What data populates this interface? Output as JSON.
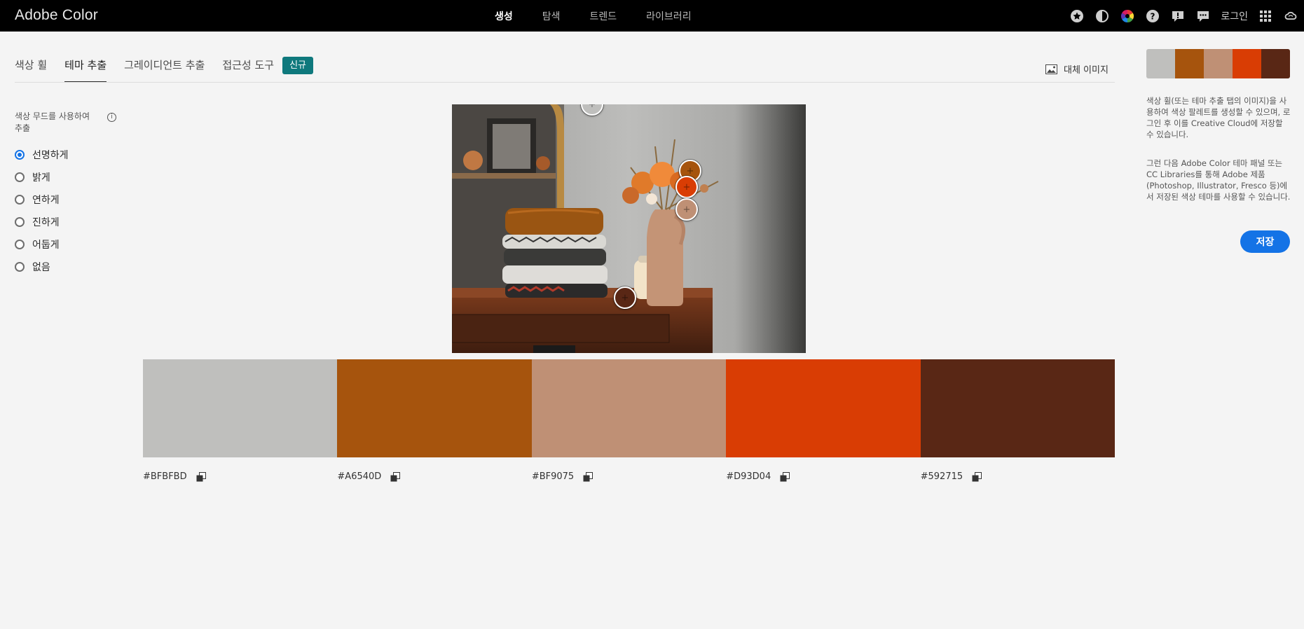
{
  "app": {
    "brand": "Adobe Color"
  },
  "nav": {
    "items": [
      {
        "label": "생성",
        "active": true
      },
      {
        "label": "탐색",
        "active": false
      },
      {
        "label": "트렌드",
        "active": false
      },
      {
        "label": "라이브러리",
        "active": false
      }
    ],
    "right_icons": [
      "star-icon",
      "contrast-icon",
      "color-wheel-icon",
      "help-icon",
      "feedback-icon",
      "chat-icon"
    ],
    "login_label": "로그인"
  },
  "tabs": {
    "items": [
      {
        "label": "색상 휠",
        "active": false
      },
      {
        "label": "테마 추출",
        "active": true
      },
      {
        "label": "그레이디언트 추출",
        "active": false
      },
      {
        "label": "접근성 도구",
        "active": false
      }
    ],
    "badge": "신규"
  },
  "alt_image_label": "대체 이미지",
  "mood": {
    "title": "색상 무드를 사용하여 추출",
    "selected": "선명하게",
    "options": [
      "선명하게",
      "밝게",
      "연하게",
      "진하게",
      "어둡게",
      "없음"
    ]
  },
  "palette": [
    {
      "hex": "#BFBFBD",
      "color": "#BFBFBD"
    },
    {
      "hex": "#A6540D",
      "color": "#A6540D"
    },
    {
      "hex": "#BF9075",
      "color": "#BF9075"
    },
    {
      "hex": "#D93D04",
      "color": "#D93D04"
    },
    {
      "hex": "#592715",
      "color": "#592715"
    }
  ],
  "side": {
    "paragraph1": "색상 휠(또는 테마 추출 탭의 이미지)을 사용하여 색상 팔레트를 생성할 수 있으며, 로그인 후 이를 Creative Cloud에 저장할 수 있습니다.",
    "paragraph2": "그런 다음 Adobe Color 테마 패널 또는 CC Libraries를 통해 Adobe 제품(Photoshop, Illustrator, Fresco 등)에서 저장된 색상 테마를 사용할 수 있습니다.",
    "save_label": "저장"
  },
  "colors": {
    "topbar": "#000000",
    "accent": "#1473E6",
    "badge": "#0F797D"
  }
}
